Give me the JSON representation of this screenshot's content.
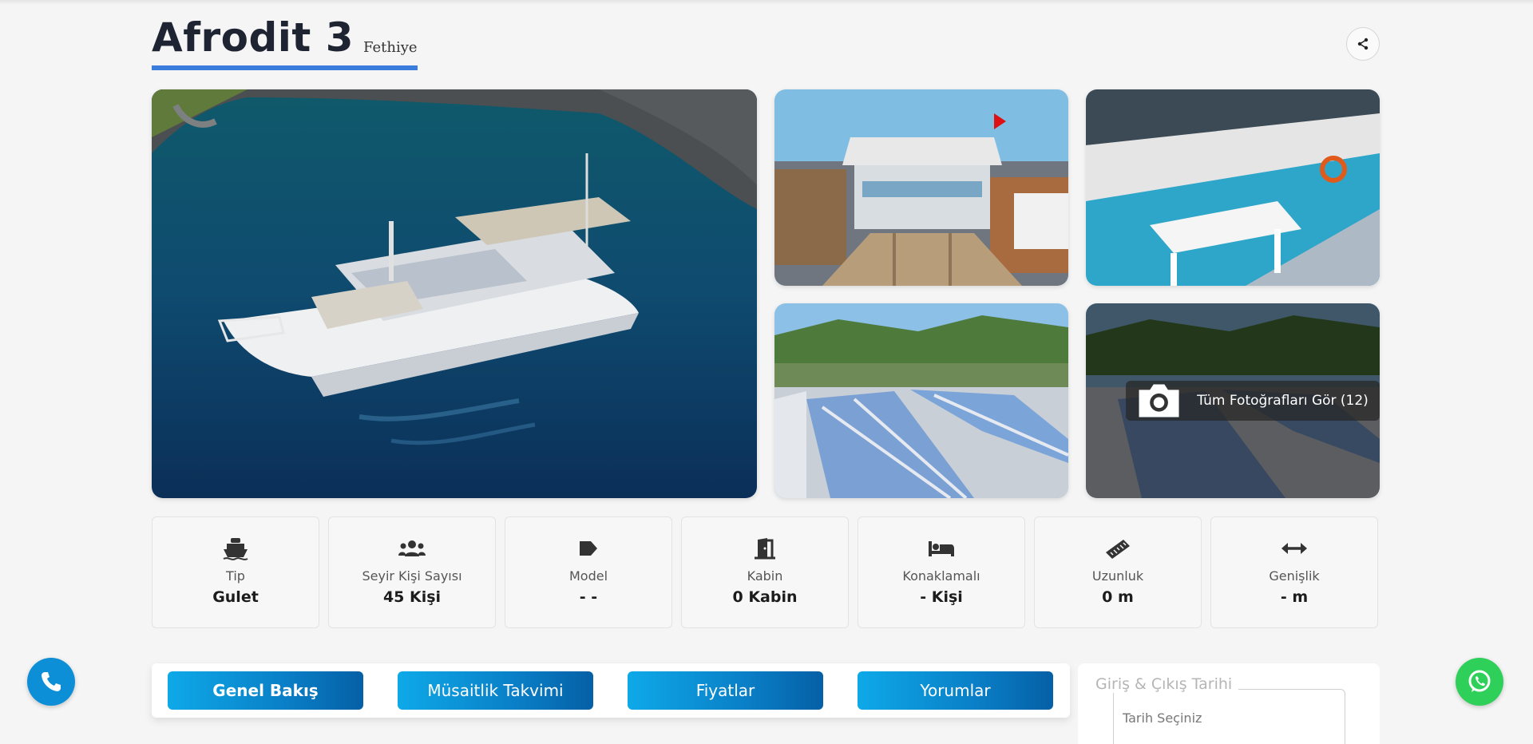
{
  "header": {
    "title": "Afrodit 3",
    "location": "Fethiye"
  },
  "gallery": {
    "all_photos_label": "Tüm Fotoğrafları Gör (12)",
    "photos": [
      {
        "subject": "boat-aerial"
      },
      {
        "subject": "boat-stern-deck"
      },
      {
        "subject": "covered-deck-tables"
      },
      {
        "subject": "sunbathing-deck"
      },
      {
        "subject": "sunbathing-deck-overlay"
      }
    ]
  },
  "specs": [
    {
      "icon": "ship-icon",
      "label": "Tip",
      "value": "Gulet"
    },
    {
      "icon": "users-icon",
      "label": "Seyir Kişi Sayısı",
      "value": "45 Kişi"
    },
    {
      "icon": "tag-icon",
      "label": "Model",
      "value": "- -"
    },
    {
      "icon": "door-icon",
      "label": "Kabin",
      "value": "0 Kabin"
    },
    {
      "icon": "bed-icon",
      "label": "Konaklamalı",
      "value": "- Kişi"
    },
    {
      "icon": "ruler-icon",
      "label": "Uzunluk",
      "value": "0 m"
    },
    {
      "icon": "arrows-horizontal-icon",
      "label": "Genişlik",
      "value": "- m"
    }
  ],
  "tabs": [
    {
      "label": "Genel Bakış",
      "active": true
    },
    {
      "label": "Müsaitlik Takvimi",
      "active": false
    },
    {
      "label": "Fiyatlar",
      "active": false
    },
    {
      "label": "Yorumlar",
      "active": false
    }
  ],
  "booking": {
    "date_legend": "Giriş & Çıkış Tarihi",
    "date_placeholder": "Tarih Seçiniz"
  },
  "colors": {
    "accent": "#3b7ddd",
    "tab_gradient_start": "#0ea9e8",
    "tab_gradient_end": "#0560a6",
    "phone_button": "#0c8fd6",
    "whatsapp_button": "#2fd05a"
  }
}
